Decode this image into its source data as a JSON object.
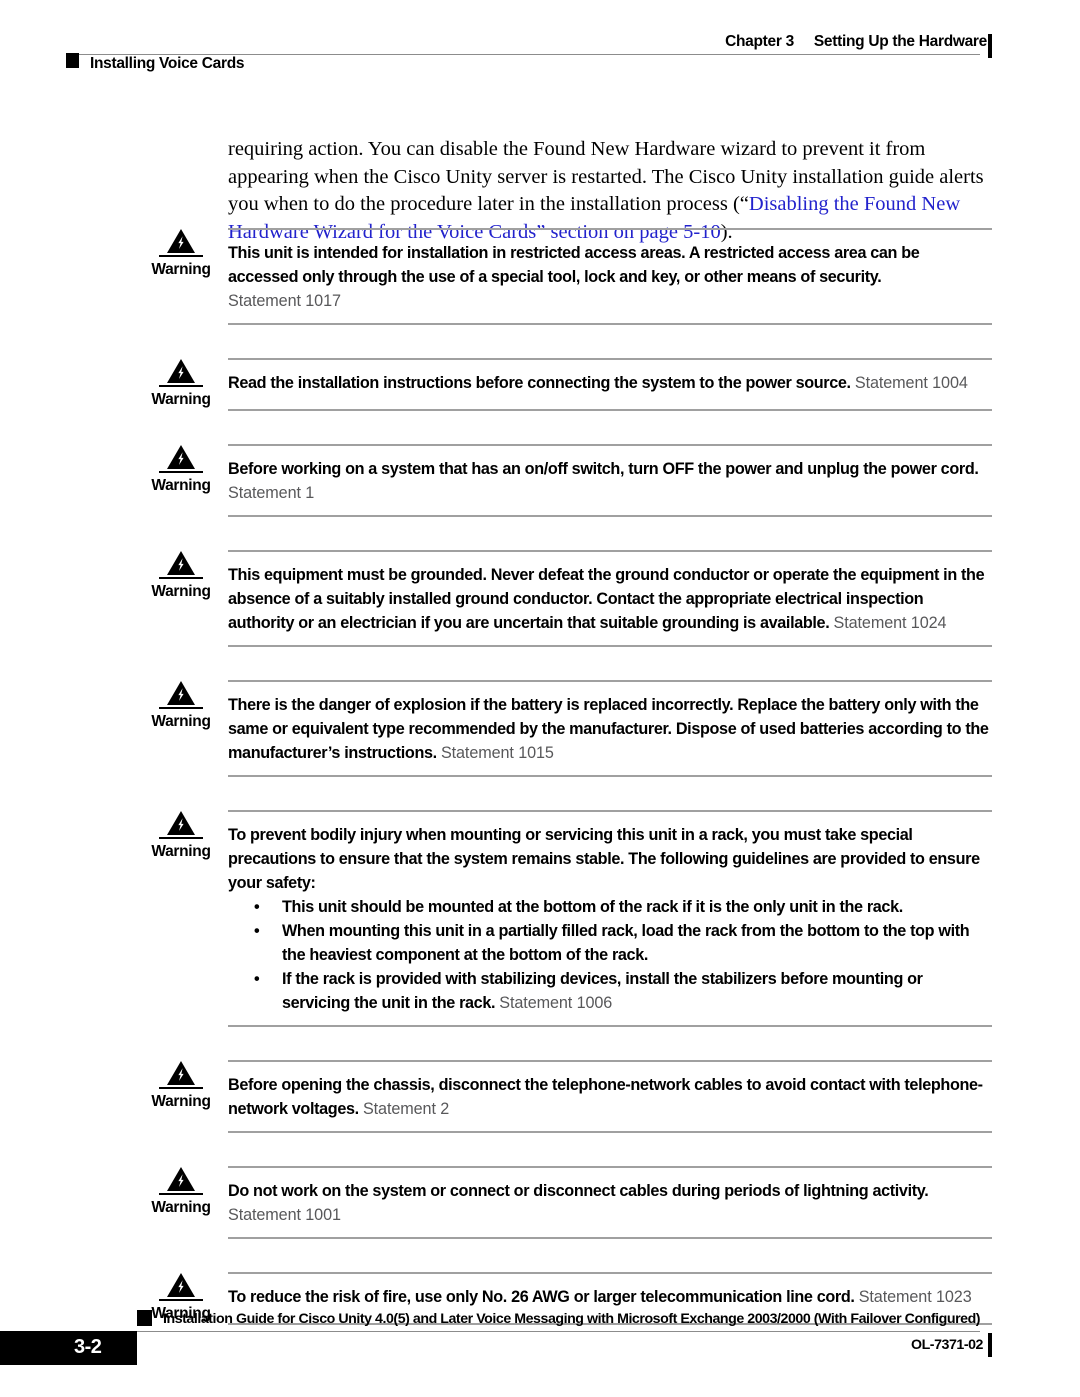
{
  "header": {
    "chapter_label": "Chapter 3",
    "chapter_title": "Setting Up the Hardware",
    "section_title": "Installing Voice Cards"
  },
  "body": {
    "paragraph_part1": "requiring action. You can disable the Found New Hardware wizard to prevent it from appearing when the Cisco Unity server is restarted. The Cisco Unity installation guide alerts you when to do the procedure later in the installation process (“",
    "link_text": "Disabling the Found New Hardware Wizard for the Voice Cards” section on page 5-10",
    "paragraph_part2": ")."
  },
  "warnings": [
    {
      "label": "Warning",
      "icon": "warning-triangle-icon",
      "text": "This unit is intended for installation in restricted access areas. A restricted access area can be accessed only through the use of a special tool, lock and key, or other means of security.",
      "statement": "Statement 1017",
      "statement_break_before": true,
      "bullets": []
    },
    {
      "label": "Warning",
      "icon": "warning-triangle-icon",
      "text": "Read the installation instructions before connecting the system to the power source.",
      "statement": "Statement 1004",
      "statement_break_before": false,
      "bullets": []
    },
    {
      "label": "Warning",
      "icon": "warning-triangle-icon",
      "text": "Before working on a system that has an on/off switch, turn OFF the power and unplug the power cord.",
      "statement": "Statement 1",
      "statement_break_before": true,
      "bullets": []
    },
    {
      "label": "Warning",
      "icon": "warning-triangle-icon",
      "text": "This equipment must be grounded. Never defeat the ground conductor or operate the equipment in the absence of a suitably installed ground conductor. Contact the appropriate electrical inspection authority or an electrician if you are uncertain that suitable grounding is available.",
      "statement": "Statement 1024",
      "statement_break_before": false,
      "bullets": []
    },
    {
      "label": "Warning",
      "icon": "warning-triangle-icon",
      "text": "There is the danger of explosion if the battery is replaced incorrectly. Replace the battery only with the same or equivalent type recommended by the manufacturer. Dispose of used batteries according to the manufacturer’s instructions.",
      "statement": "Statement 1015",
      "statement_break_before": false,
      "bullets": []
    },
    {
      "label": "Warning",
      "icon": "warning-triangle-icon",
      "text": "To prevent bodily injury when mounting or servicing this unit in a rack, you must take special precautions to ensure that the system remains stable. The following guidelines are provided to ensure your safety:",
      "statement": "",
      "statement_break_before": false,
      "bullets": [
        {
          "text": "This unit should be mounted at the bottom of the rack if it is the only unit in the rack.",
          "statement": ""
        },
        {
          "text": "When mounting this unit in a partially filled rack, load the rack from the bottom to the top with the heaviest component at the bottom of the rack.",
          "statement": ""
        },
        {
          "text": "If the rack is provided with stabilizing devices, install the stabilizers before mounting or servicing the unit in the rack.",
          "statement": "Statement 1006"
        }
      ]
    },
    {
      "label": "Warning",
      "icon": "warning-triangle-icon",
      "text": "Before opening the chassis, disconnect the telephone-network cables to avoid contact with telephone-network voltages.",
      "statement": "Statement 2",
      "statement_break_before": false,
      "bullets": []
    },
    {
      "label": "Warning",
      "icon": "warning-triangle-icon",
      "text": "Do not work on the system or connect or disconnect cables during periods of lightning activity.",
      "statement": "Statement 1001",
      "statement_break_before": true,
      "bullets": []
    },
    {
      "label": "Warning",
      "icon": "warning-triangle-icon",
      "text": "To reduce the risk of fire, use only No. 26 AWG or larger telecommunication line cord.",
      "statement": "Statement 1023",
      "statement_break_before": false,
      "bullets": []
    }
  ],
  "footer": {
    "page_number": "3-2",
    "guide_title": "Installation Guide for Cisco Unity 4.0(5) and Later Voice Messaging with Microsoft Exchange 2003/2000 (With Failover Configured)",
    "doc_id": "OL-7371-02"
  },
  "colors": {
    "link": "#2222cc",
    "rule": "#a0a0a0",
    "statement_text": "#58585a",
    "page_box": "#000000"
  }
}
